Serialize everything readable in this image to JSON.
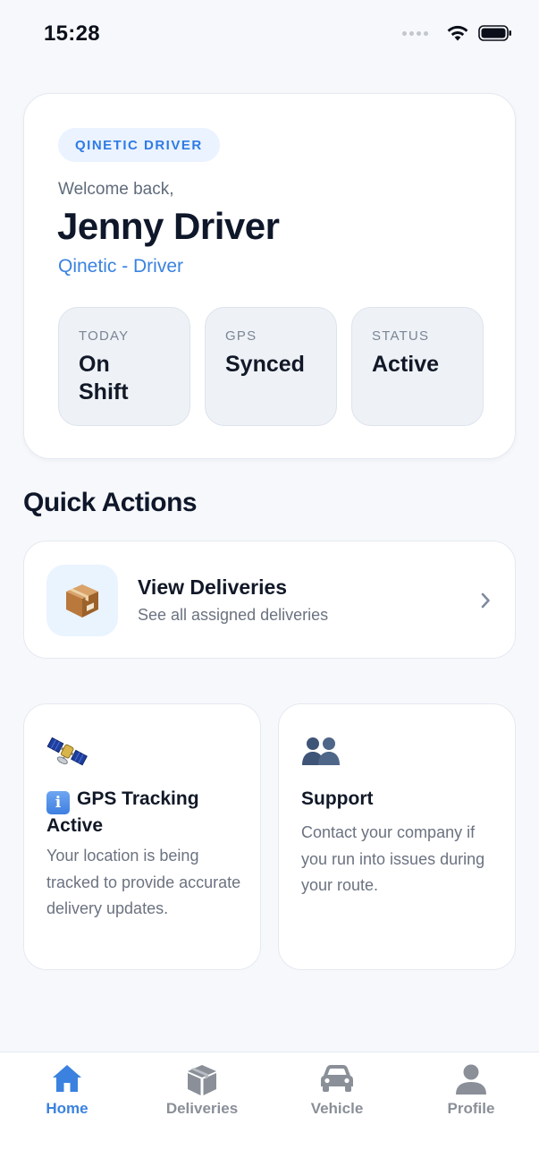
{
  "status_bar": {
    "time": "15:28"
  },
  "profile": {
    "role_badge": "QINETIC DRIVER",
    "welcome": "Welcome back,",
    "name": "Jenny Driver",
    "company": "Qinetic - Driver",
    "stats": [
      {
        "label": "TODAY",
        "value": "On Shift"
      },
      {
        "label": "GPS",
        "value": "Synced"
      },
      {
        "label": "STATUS",
        "value": "Active"
      }
    ]
  },
  "quick_actions": {
    "title": "Quick Actions",
    "view_deliveries": {
      "title": "View Deliveries",
      "subtitle": "See all assigned deliveries",
      "icon": "package-icon"
    }
  },
  "info_cards": {
    "gps": {
      "icon": "satellite-icon",
      "badge": "i",
      "title": "GPS Tracking Active",
      "body": "Your location is being tracked to provide accurate delivery updates."
    },
    "support": {
      "icon": "people-icon",
      "title": "Support",
      "body": "Contact your company if you run into issues during your route."
    }
  },
  "bottom_nav": {
    "active": "home",
    "items": [
      {
        "id": "home",
        "label": "Home",
        "icon": "home-icon"
      },
      {
        "id": "deliveries",
        "label": "Deliveries",
        "icon": "cube-icon"
      },
      {
        "id": "vehicle",
        "label": "Vehicle",
        "icon": "car-icon"
      },
      {
        "id": "profile",
        "label": "Profile",
        "icon": "person-icon"
      }
    ]
  },
  "colors": {
    "accent": "#3B82E0",
    "background": "#F6F8FB",
    "card": "#FFFFFF",
    "tile": "#EEF2F7",
    "muted_text": "#6B7280",
    "inactive_nav": "#8A8F98"
  }
}
